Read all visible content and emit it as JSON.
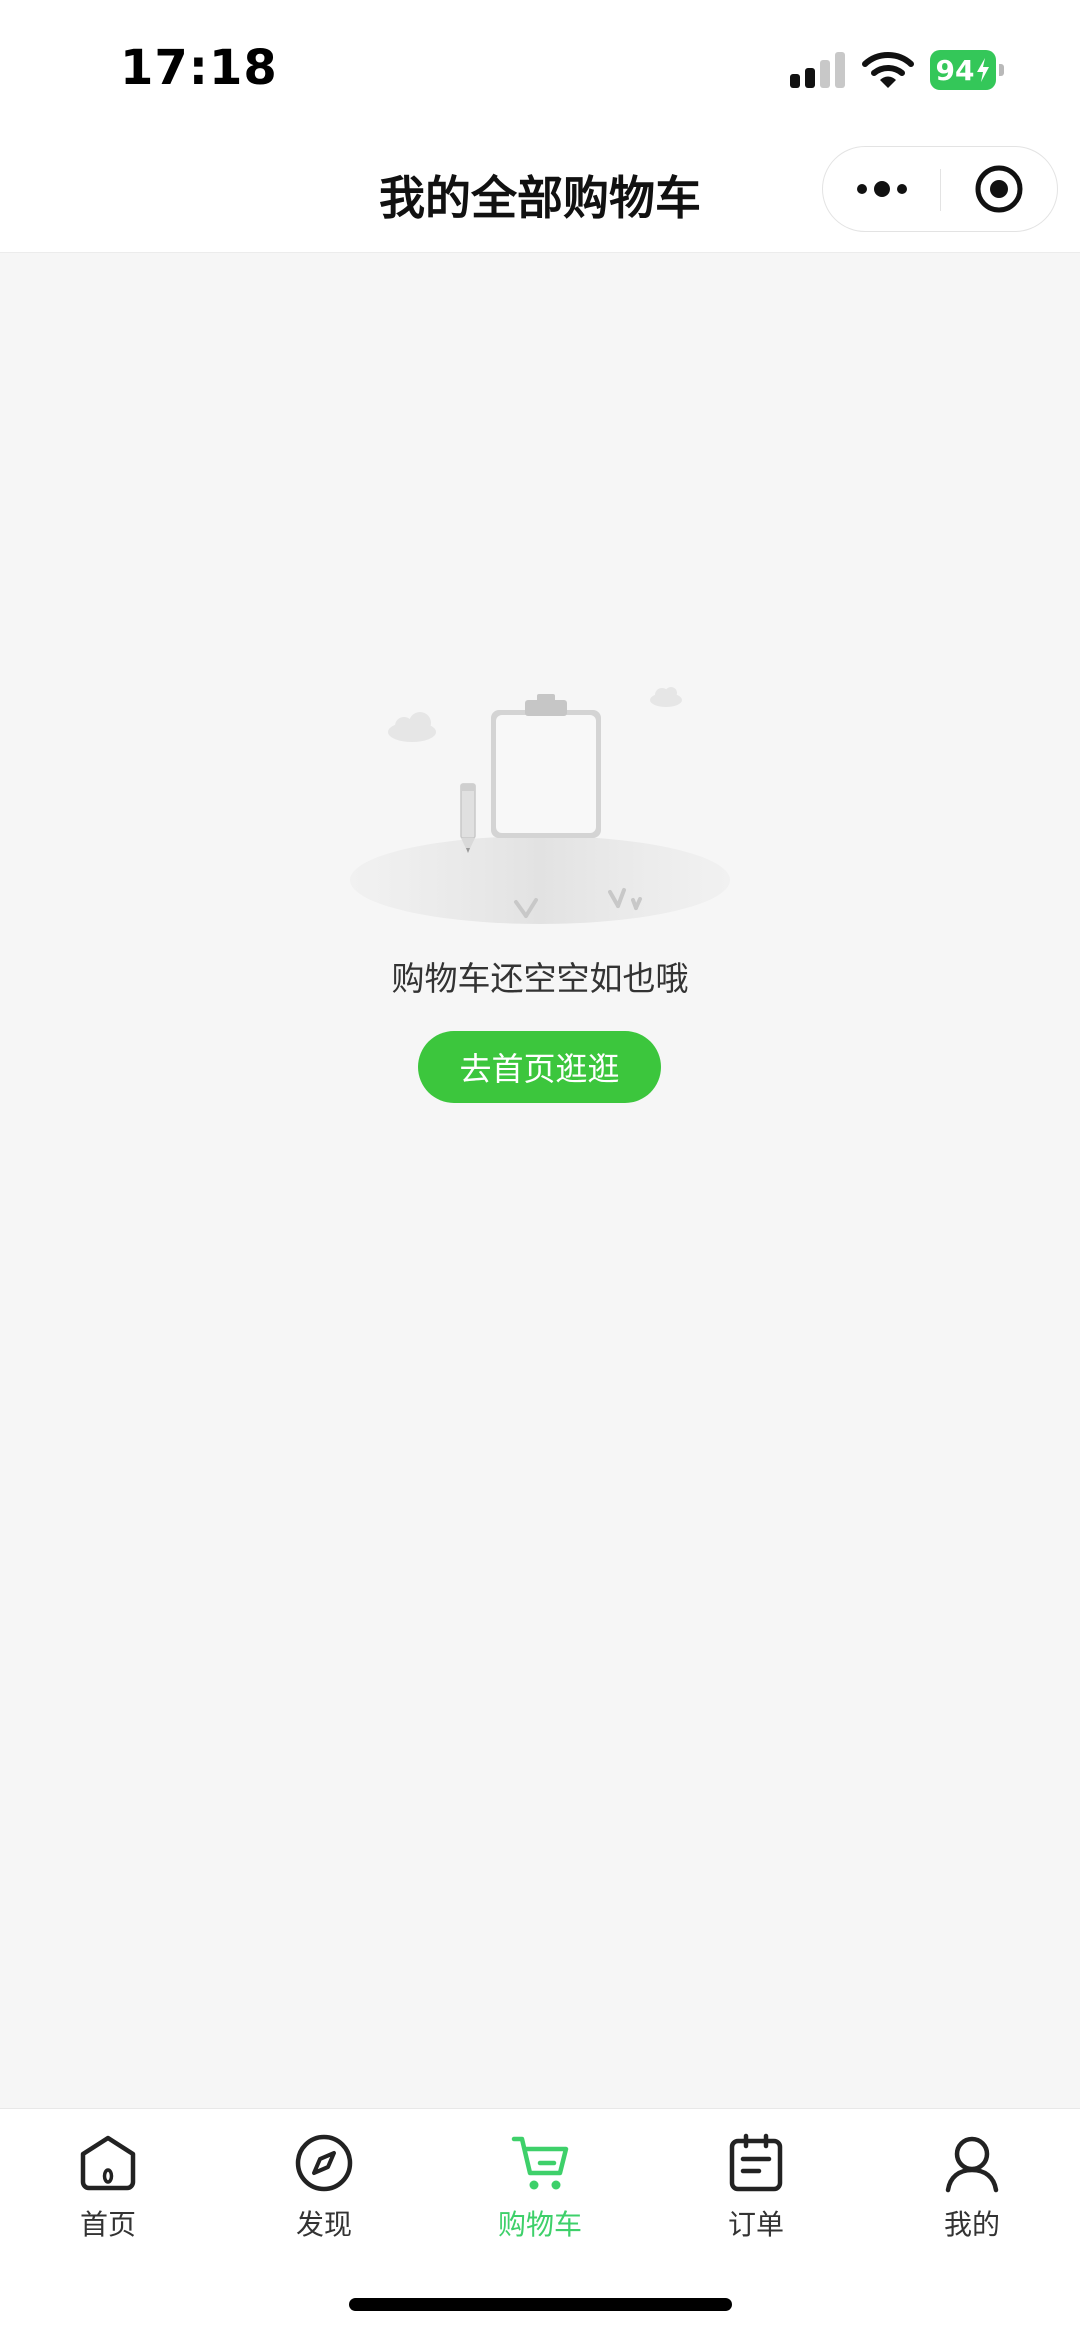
{
  "status_bar": {
    "time": "17:18",
    "battery": "94",
    "icons": [
      "signal-icon",
      "wifi-icon",
      "battery-charging-icon"
    ]
  },
  "nav": {
    "title": "我的全部购物车",
    "more_icon": "more-dots-icon",
    "close_icon": "target-close-icon"
  },
  "empty_state": {
    "illustration": "empty-clipboard-illustration",
    "message": "购物车还空空如也哦",
    "button_label": "去首页逛逛"
  },
  "tab_bar": {
    "items": [
      {
        "label": "首页",
        "icon": "home-icon",
        "active": false
      },
      {
        "label": "发现",
        "icon": "compass-icon",
        "active": false
      },
      {
        "label": "购物车",
        "icon": "cart-icon",
        "active": true
      },
      {
        "label": "订单",
        "icon": "order-icon",
        "active": false
      },
      {
        "label": "我的",
        "icon": "profile-icon",
        "active": false
      }
    ]
  },
  "colors": {
    "accent_green": "#3cc63d",
    "active_tab_green": "#3ed06a",
    "battery_green": "#34c759",
    "page_background": "#f6f6f6"
  }
}
